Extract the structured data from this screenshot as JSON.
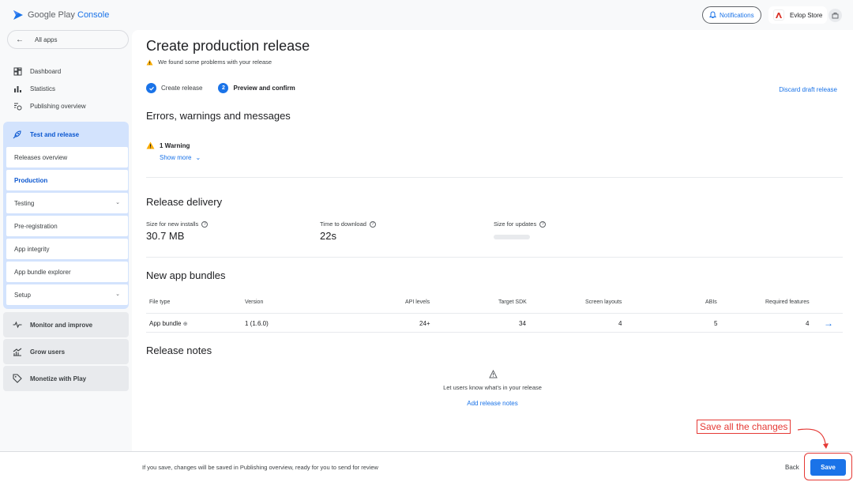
{
  "header": {
    "logo_text_a": "Google Play",
    "logo_text_b": "Console",
    "notifications_label": "Notifications",
    "store_name": "Evlop Store"
  },
  "sidebar": {
    "all_apps": "All apps",
    "top_items": [
      {
        "label": "Dashboard",
        "icon": "dashboard-icon"
      },
      {
        "label": "Statistics",
        "icon": "bar-chart-icon"
      },
      {
        "label": "Publishing overview",
        "icon": "publishing-icon"
      }
    ],
    "test_release": {
      "label": "Test and release",
      "items": [
        "Releases overview",
        "Production",
        "Testing",
        "Pre-registration",
        "App integrity",
        "App bundle explorer",
        "Setup"
      ],
      "active": "Production"
    },
    "groups": [
      {
        "label": "Monitor and improve",
        "icon": "monitor-icon"
      },
      {
        "label": "Grow users",
        "icon": "grow-icon"
      },
      {
        "label": "Monetize with Play",
        "icon": "tag-icon"
      }
    ]
  },
  "main": {
    "title": "Create production release",
    "warning_banner": "We found some problems with your release",
    "steps": [
      {
        "label": "Create release",
        "status": "done"
      },
      {
        "label": "Preview and confirm",
        "number": "2",
        "status": "current"
      }
    ],
    "discard_label": "Discard draft release",
    "errors_title": "Errors, warnings and messages",
    "warning_count": "1 Warning",
    "show_more": "Show more",
    "delivery_title": "Release delivery",
    "delivery": {
      "size_new_label": "Size for new installs",
      "size_new_value": "30.7 MB",
      "time_label": "Time to download",
      "time_value": "22s",
      "size_updates_label": "Size for updates"
    },
    "bundles_title": "New app bundles",
    "bundles_table": {
      "headers": [
        "File type",
        "Version",
        "API levels",
        "Target SDK",
        "Screen layouts",
        "ABIs",
        "Required features"
      ],
      "rows": [
        {
          "file_type": "App bundle",
          "version": "1 (1.6.0)",
          "api_levels": "24+",
          "target_sdk": "34",
          "screen_layouts": "4",
          "abis": "5",
          "required_features": "4"
        }
      ]
    },
    "notes_title": "Release notes",
    "notes_empty_msg": "Let users know what's in your release",
    "add_notes_label": "Add release notes"
  },
  "footer": {
    "message": "If you save, changes will be saved in Publishing overview, ready for you to send for review",
    "back_label": "Back",
    "save_label": "Save"
  },
  "annotation": {
    "text": "Save all the changes",
    "color": "#e53935"
  },
  "colors": {
    "accent": "#1a73e8",
    "nav_active_bg": "#d3e3fd",
    "warning": "#f9ab00"
  }
}
